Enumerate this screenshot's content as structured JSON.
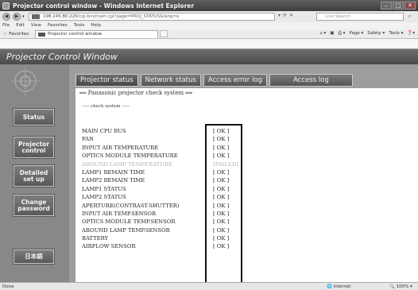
{
  "window": {
    "title": "Projector control window - Windows Internet Explorer"
  },
  "address_bar": {
    "url_host": "198.245.80.220",
    "url_rest": "/cgi-bin/main.cgi?page=PROJ_STATUS&lang=e",
    "search_placeholder": "Live Search"
  },
  "menu": [
    "File",
    "Edit",
    "View",
    "Favorites",
    "Tools",
    "Help"
  ],
  "favorites": {
    "label": "Favorites",
    "tab_title": "Projector control window"
  },
  "command_bar": [
    "Page ▾",
    "Safety ▾",
    "Tools ▾"
  ],
  "page": {
    "title": "Projector Control Window"
  },
  "sidebar": {
    "items": [
      {
        "label": "Status"
      },
      {
        "label": "Projector\ncontrol"
      },
      {
        "label": "Detailed\nset up"
      },
      {
        "label": "Change\npassword"
      },
      {
        "label": "日本語"
      }
    ]
  },
  "tabs": [
    {
      "label": "Projector status",
      "active": true
    },
    {
      "label": "Network status",
      "active": false
    },
    {
      "label": "Access error log",
      "active": false
    },
    {
      "label": "Access log",
      "active": false
    }
  ],
  "content": {
    "heading": "══ Panasonic projector check system ══",
    "subheading": "----- check system -----",
    "rows": [
      {
        "label": "MAIN CPU BUS",
        "value": "[ OK ]"
      },
      {
        "label": "FAN",
        "value": "[ OK ]"
      },
      {
        "label": "INPUT AIR TEMPERATURE",
        "value": "[ OK ]"
      },
      {
        "label": "OPTICS MODULE TEMPERATURE",
        "value": "[ OK ]"
      },
      {
        "label": "AROUND LAMP TEMPERATURE",
        "value": "[FAILED]",
        "failed": true
      },
      {
        "label": "LAMP1 REMAIN TIME",
        "value": "[ OK ]"
      },
      {
        "label": "LAMP2 REMAIN TIME",
        "value": "[ OK ]"
      },
      {
        "label": "LAMP1 STATUS",
        "value": "[ OK ]"
      },
      {
        "label": "LAMP2 STATUS",
        "value": "[ OK ]"
      },
      {
        "label": "APERTURE(CONTRAST-SHUTTER)",
        "value": "[ OK ]"
      },
      {
        "label": "INPUT AIR TEMP.SENSOR",
        "value": "[ OK ]"
      },
      {
        "label": "OPTICS MODULE TEMP.SENSOR",
        "value": "[ OK ]"
      },
      {
        "label": "AROUND LAMP TEMP.SENSOR",
        "value": "[ OK ]"
      },
      {
        "label": "BATTERY",
        "value": "[ OK ]"
      },
      {
        "label": "AIRFLOW SENSOR",
        "value": "[ OK ]"
      }
    ]
  },
  "status_bar": {
    "left": "Done",
    "zone": "Internet",
    "zoom": "100%"
  }
}
